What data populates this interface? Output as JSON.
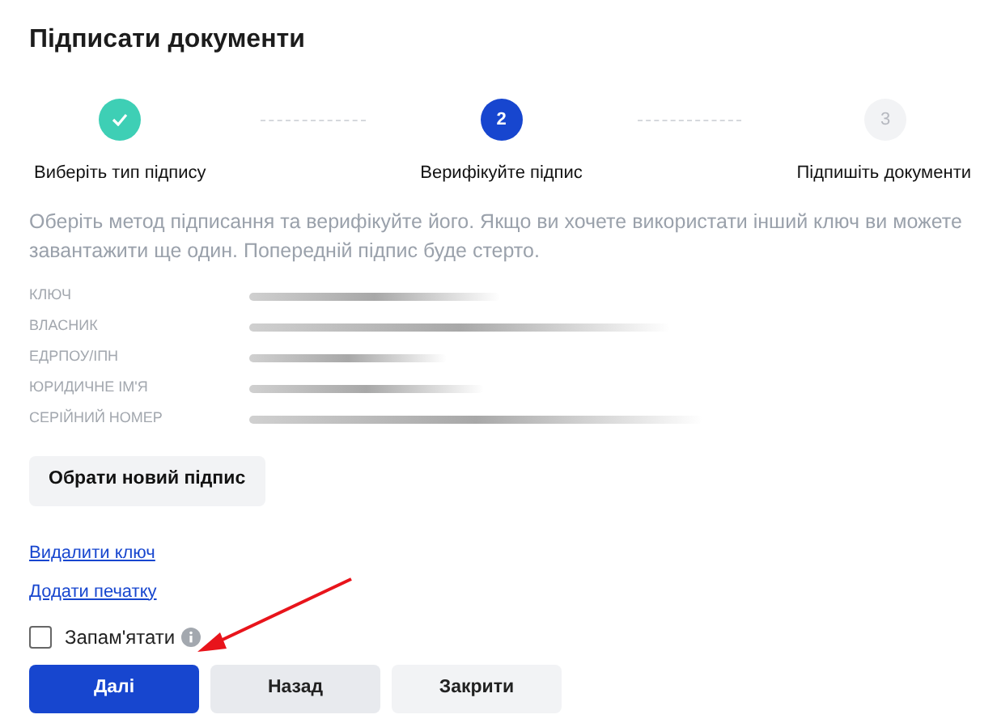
{
  "title": "Підписати документи",
  "steps": [
    {
      "label": "Виберіть тип підпису",
      "kind": "done"
    },
    {
      "number": "2",
      "label": "Верифікуйте підпис",
      "kind": "current"
    },
    {
      "number": "3",
      "label": "Підпишіть документи",
      "kind": "upcoming"
    }
  ],
  "description": "Оберіть метод підписання та верифікуйте його. Якщо ви хочете використати інший ключ ви можете завантажити ще один. Попередній підпис буде стерто.",
  "fields": [
    {
      "label": "КЛЮЧ",
      "redacted": true
    },
    {
      "label": "ВЛАСНИК",
      "redacted": true
    },
    {
      "label": "ЕДРПОУ/ІПН",
      "redacted": true
    },
    {
      "label": "ЮРИДИЧНЕ ІМ'Я",
      "redacted": true
    },
    {
      "label": "СЕРІЙНИЙ НОМЕР",
      "redacted": true
    }
  ],
  "choose_button": "Обрати новий підпис",
  "links": [
    "Видалити ключ",
    "Додати печатку"
  ],
  "remember": {
    "label": "Запам'ятати",
    "checked": false
  },
  "buttons": [
    {
      "label": "Далі",
      "kind": "primary"
    },
    {
      "label": "Назад",
      "kind": "secondary"
    },
    {
      "label": "Закрити",
      "kind": "tertiary"
    }
  ]
}
